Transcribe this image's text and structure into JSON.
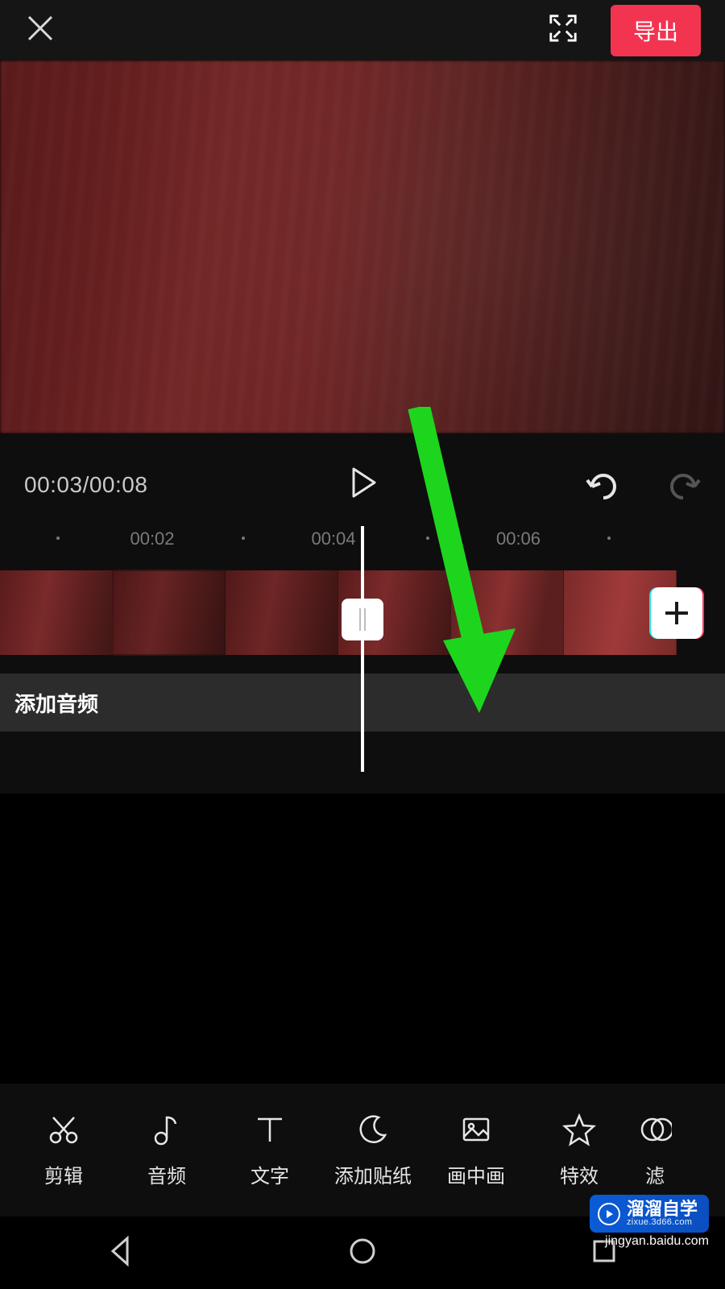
{
  "topbar": {
    "export_label": "导出"
  },
  "playback": {
    "current": "00:03",
    "total": "00:08"
  },
  "ruler": {
    "ticks": [
      {
        "label": "00:02",
        "x_pct": 21
      },
      {
        "label": "00:04",
        "x_pct": 46
      },
      {
        "label": "00:06",
        "x_pct": 71.5
      }
    ],
    "dots_pct": [
      8,
      33.5,
      59,
      84
    ]
  },
  "timeline": {
    "audio_row_label": "添加音频"
  },
  "tools": [
    {
      "name": "edit",
      "label": "剪辑",
      "icon": "scissors-icon"
    },
    {
      "name": "audio",
      "label": "音频",
      "icon": "music-note-icon"
    },
    {
      "name": "text",
      "label": "文字",
      "icon": "text-icon"
    },
    {
      "name": "sticker",
      "label": "添加贴纸",
      "icon": "moon-icon"
    },
    {
      "name": "pip",
      "label": "画中画",
      "icon": "image-icon"
    },
    {
      "name": "effects",
      "label": "特效",
      "icon": "star-icon"
    },
    {
      "name": "filter",
      "label": "滤",
      "icon": "filter-partial-icon"
    }
  ],
  "watermark": {
    "brand": "溜溜自学",
    "domain": "zixue.3d66.com",
    "subtext": "jingyan.baidu.com"
  }
}
